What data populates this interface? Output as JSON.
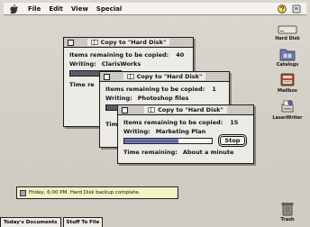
{
  "menubar": {
    "items": [
      "File",
      "Edit",
      "View",
      "Special"
    ]
  },
  "desktop_icons": {
    "hard_disk": "Hard Disk",
    "catalogs": "Catalogs",
    "mailbox": "Mailbox",
    "laserwriter": "LaserWriter",
    "trash": "Trash"
  },
  "windows": [
    {
      "title": "Copy to \"Hard Disk\"",
      "remaining_label": "Items remaining to be copied:",
      "remaining_count": "40",
      "writing_label": "Writing:",
      "writing_value": "ClarisWorks",
      "time_label": "Time re"
    },
    {
      "title": "Copy to \"Hard Disk\"",
      "remaining_label": "Items remaining to be copied:",
      "remaining_count": "1",
      "writing_label": "Writing:",
      "writing_value": "Photoshop files",
      "time_label": "Time"
    },
    {
      "title": "Copy to \"Hard Disk\"",
      "remaining_label": "Items remaining to be copied:",
      "remaining_count": "15",
      "writing_label": "Writing:",
      "writing_value": "Marketing Plan",
      "stop_label": "Stop",
      "time_label": "Time remaining:",
      "time_value": "About a minute",
      "progress": 0.62
    }
  ],
  "notification": {
    "text": "Friday, 6:00 PM. Hard Disk backup complete."
  },
  "tabs": [
    "Today's Documents",
    "Stuff To File"
  ]
}
